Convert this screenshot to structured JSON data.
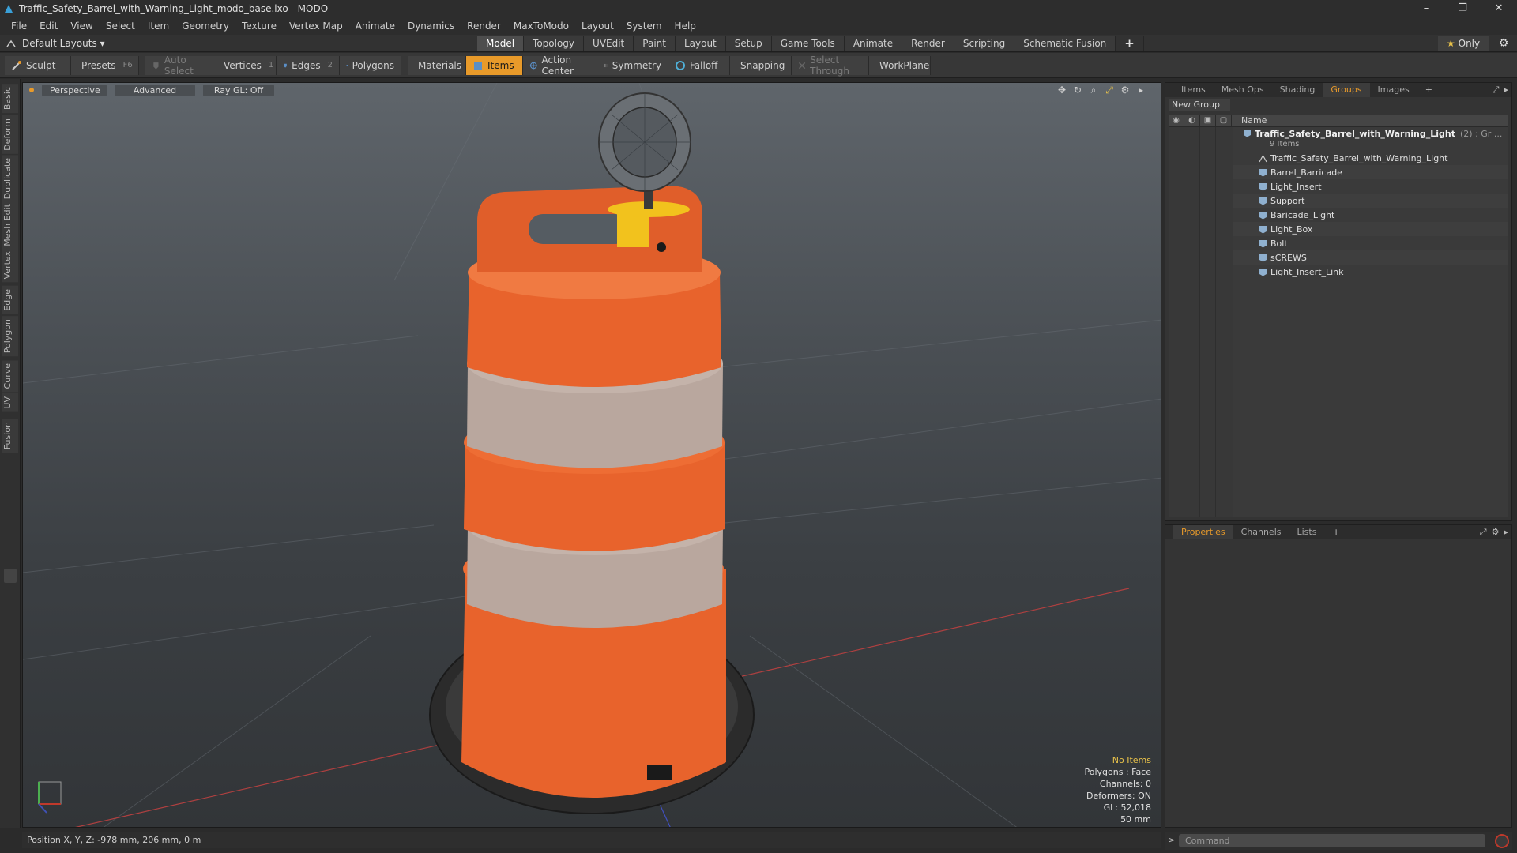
{
  "window": {
    "title": "Traffic_Safety_Barrel_with_Warning_Light_modo_base.lxo - MODO",
    "minimize": "–",
    "restore": "❐",
    "close": "✕"
  },
  "menu": [
    "File",
    "Edit",
    "View",
    "Select",
    "Item",
    "Geometry",
    "Texture",
    "Vertex Map",
    "Animate",
    "Dynamics",
    "Render",
    "MaxToModo",
    "Layout",
    "System",
    "Help"
  ],
  "layoutbar": {
    "layouts_label": "Default Layouts ▾",
    "tabs": [
      "Model",
      "Topology",
      "UVEdit",
      "Paint",
      "Layout",
      "Setup",
      "Game Tools",
      "Animate",
      "Render",
      "Scripting",
      "Schematic Fusion"
    ],
    "active_tab": "Model",
    "plus": "+",
    "only_star": "★",
    "only_label": "Only",
    "gear": "⚙"
  },
  "toolbar": {
    "sculpt": "Sculpt",
    "presets": "Presets",
    "presets_key": "F6",
    "auto_select": "Auto Select",
    "vertices": "Vertices",
    "vertices_count": "1",
    "edges": "Edges",
    "edges_count": "2",
    "polygons": "Polygons",
    "materials": "Materials",
    "items": "Items",
    "action_center": "Action Center",
    "symmetry": "Symmetry",
    "falloff": "Falloff",
    "snapping": "Snapping",
    "select_through": "Select Through",
    "workplane": "WorkPlane"
  },
  "left_tabs": [
    "Basic",
    "Deform",
    "Duplicate",
    "Mesh Edit",
    "Vertex",
    "Edge",
    "Polygon",
    "Curve",
    "UV",
    "Fusion"
  ],
  "viewport": {
    "perspective": "Perspective",
    "advanced": "Advanced",
    "raygl": "Ray GL: Off",
    "icons": [
      "✥",
      "↻",
      "⌕",
      "⤢",
      "⚙",
      "▸"
    ],
    "stats": {
      "no_items": "No Items",
      "polygons": "Polygons : Face",
      "channels": "Channels: 0",
      "deformers": "Deformers: ON",
      "gl": "GL: 52,018",
      "scale": "50 mm"
    }
  },
  "statusbar": {
    "position": "Position X, Y, Z:  -978 mm, 206 mm, 0 m"
  },
  "groups_panel": {
    "tabs": [
      "Items",
      "Mesh Ops",
      "Shading",
      "Groups",
      "Images"
    ],
    "active_tab": "Groups",
    "plus": "+",
    "new_group": "New Group",
    "header_name": "Name",
    "parent": {
      "name": "Traffic_Safety_Barrel_with_Warning_Light",
      "suffix": "(2) : Gr ...",
      "count": "9 Items"
    },
    "items": [
      "Traffic_Safety_Barrel_with_Warning_Light",
      "Barrel_Barricade",
      "Light_Insert",
      "Support",
      "Baricade_Light",
      "Light_Box",
      "Bolt",
      "sCREWS",
      "Light_Insert_Link"
    ]
  },
  "properties_panel": {
    "tabs": [
      "Properties",
      "Channels",
      "Lists"
    ],
    "active_tab": "Properties",
    "plus": "+"
  },
  "command": {
    "arrow": ">",
    "placeholder": "Command"
  },
  "colors": {
    "accent": "#e89a2a",
    "barrel_orange": "#e8632c",
    "barrel_white": "#b9a79e",
    "light_yellow": "#f2c21d",
    "base_black": "#2a2a2a"
  }
}
